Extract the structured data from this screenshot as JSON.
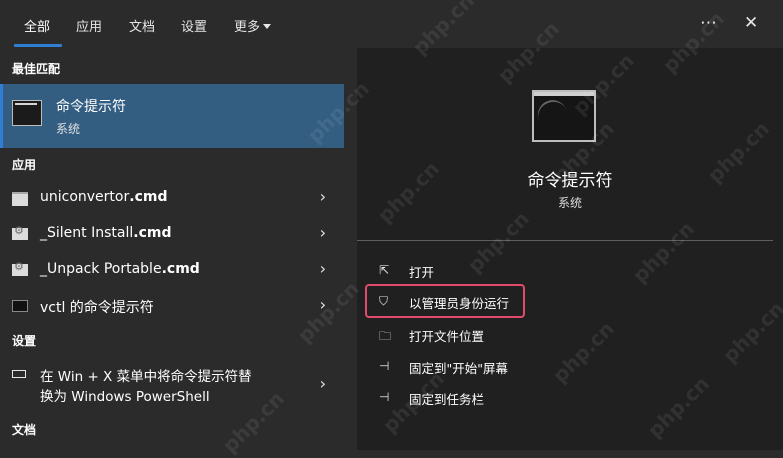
{
  "tabs": [
    {
      "label": "全部",
      "active": true
    },
    {
      "label": "应用"
    },
    {
      "label": "文档"
    },
    {
      "label": "设置"
    },
    {
      "label": "更多"
    }
  ],
  "top_icons": {
    "more": "more-horiz-icon",
    "close": "close-icon"
  },
  "left": {
    "best_match_header": "最佳匹配",
    "best_match": {
      "title": "命令提示符",
      "subtitle": "系统"
    },
    "apps_header": "应用",
    "apps": [
      {
        "name_plain": "uniconvertor",
        "name_bold": ".cmd"
      },
      {
        "name_plain": "_Silent Install",
        "name_bold": ".cmd"
      },
      {
        "name_plain": "_Unpack Portable",
        "name_bold": ".cmd"
      },
      {
        "name_plain": "vctl 的命令提示符",
        "name_bold": ""
      }
    ],
    "settings_header": "设置",
    "setting": {
      "line1": "在 Win + X 菜单中将命令提示符替",
      "line2": "换为 Windows PowerShell"
    },
    "docs_header": "文档"
  },
  "right": {
    "title": "命令提示符",
    "subtitle": "系统",
    "actions": [
      {
        "label": "打开",
        "icon": "open-icon"
      },
      {
        "label": "以管理员身份运行",
        "icon": "shield-icon"
      },
      {
        "label": "打开文件位置",
        "icon": "folder-icon"
      },
      {
        "label": "固定到\"开始\"屏幕",
        "icon": "pin-icon"
      },
      {
        "label": "固定到任务栏",
        "icon": "pin-taskbar-icon"
      }
    ]
  },
  "colors": {
    "accent": "#2f7fd7",
    "selected_bg": "#335e82",
    "highlight_box": "#e24a6b"
  },
  "watermark": "php.cn"
}
